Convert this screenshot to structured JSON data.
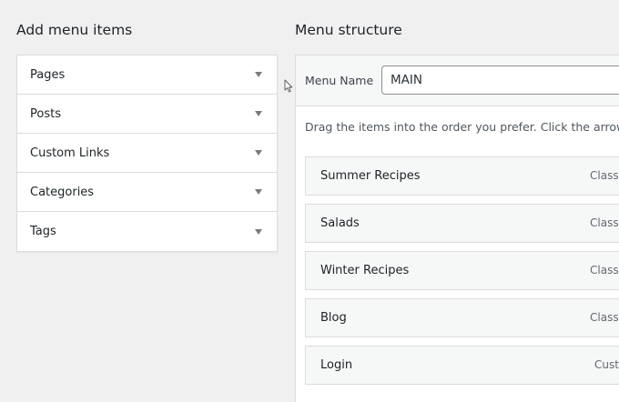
{
  "left": {
    "heading": "Add menu items",
    "items": [
      {
        "label": "Pages",
        "icon": "arrow-down-icon"
      },
      {
        "label": "Posts",
        "icon": "arrow-down-icon"
      },
      {
        "label": "Custom Links",
        "icon": "arrow-down-icon"
      },
      {
        "label": "Categories",
        "icon": "arrow-down-icon"
      },
      {
        "label": "Tags",
        "icon": "arrow-down-icon"
      }
    ]
  },
  "right": {
    "heading": "Menu structure",
    "menu_name_label": "Menu Name",
    "menu_name_value": "MAIN",
    "instructions": "Drag the items into the order you prefer. Click the arrow on",
    "items": [
      {
        "title": "Summer Recipes",
        "type": "Classic"
      },
      {
        "title": "Salads",
        "type": "Classic"
      },
      {
        "title": "Winter Recipes",
        "type": "Classic"
      },
      {
        "title": "Blog",
        "type": "Classic"
      },
      {
        "title": "Login",
        "type": "Custom"
      }
    ]
  },
  "colors": {
    "background": "#f0f0f1",
    "panel": "#ffffff",
    "border": "#dcdcde",
    "text": "#1d2327",
    "muted": "#646970"
  }
}
